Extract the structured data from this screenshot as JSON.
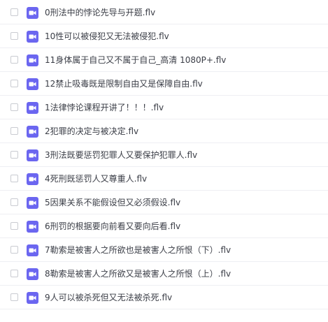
{
  "file_icon": "video-file-icon",
  "file_icon_color": "#6b66f0",
  "files": [
    {
      "name": "0刑法中的悖论先导与开题.flv"
    },
    {
      "name": "10性可以被侵犯又无法被侵犯.flv"
    },
    {
      "name": "11身体属于自己又不属于自己_高清 1080P+.flv"
    },
    {
      "name": "12禁止吸毒既是限制自由又是保障自由.flv"
    },
    {
      "name": "1法律悖论课程开讲了！！！.flv"
    },
    {
      "name": "2犯罪的决定与被决定.flv"
    },
    {
      "name": "3刑法既要惩罚犯罪人又要保护犯罪人.flv"
    },
    {
      "name": "4死刑既惩罚人又尊重人.flv"
    },
    {
      "name": "5因果关系不能假设但又必须假设.flv"
    },
    {
      "name": "6刑罚的根据要向前看又要向后看.flv"
    },
    {
      "name": "7勒索是被害人之所欲也是被害人之所恨（下）.flv"
    },
    {
      "name": "8勒索是被害人之所欲又是被害人之所恨（上）.flv"
    },
    {
      "name": "9人可以被杀死但又无法被杀死.flv"
    }
  ]
}
